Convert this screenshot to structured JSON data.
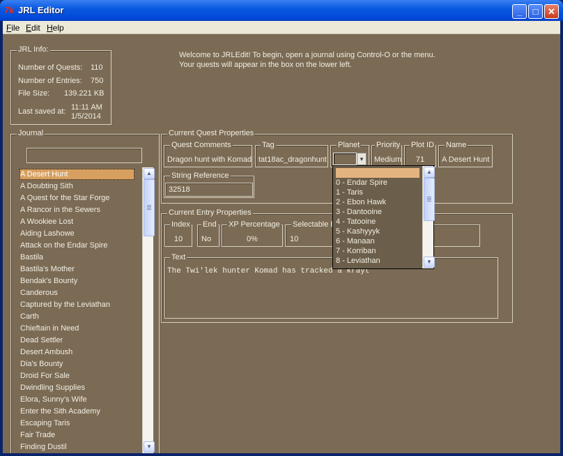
{
  "window": {
    "title": "JRL Editor",
    "min_label": "_",
    "max_label": "□",
    "close_label": "✕"
  },
  "menubar": {
    "file": "File",
    "edit": "Edit",
    "help": "Help"
  },
  "info": {
    "label": "JRL Info:",
    "quests_label": "Number of Quests:",
    "quests_value": "110",
    "entries_label": "Number of Entries:",
    "entries_value": "750",
    "filesize_label": "File Size:",
    "filesize_value": "139.221 KB",
    "lastsaved_label": "Last saved at:",
    "lastsaved_time": "11:11 AM",
    "lastsaved_date": "1/5/2014"
  },
  "welcome": {
    "line1": "Welcome to JRLEdit! To begin, open a journal using Control-O or the menu.",
    "line2": "Your quests will appear in the box on the lower left."
  },
  "journal": {
    "label": "Journal",
    "search_value": "",
    "items": [
      "A Desert Hunt",
      "A Doubting Sith",
      "A Quest for the Star Forge",
      "A Rancor in the Sewers",
      "A Wookiee Lost",
      "Aiding Lashowe",
      "Attack on the Endar Spire",
      "Bastila",
      "Bastila's Mother",
      "Bendak's Bounty",
      "Canderous",
      "Captured by the Leviathan",
      "Carth",
      "Chieftain in Need",
      "Dead Settler",
      "Desert Ambush",
      "Dia's Bounty",
      "Droid For Sale",
      "Dwindling Supplies",
      "Elora, Sunny's Wife",
      "Enter the Sith Academy",
      "Escaping Taris",
      "Fair Trade",
      "Finding Dustil"
    ]
  },
  "quest": {
    "label": "Current Quest Properties",
    "comments_label": "Quest Comments",
    "comments_value": "Dragon hunt with Komad",
    "tag_label": "Tag",
    "tag_value": "tat18ac_dragonhunt",
    "planet_label": "Planet",
    "planet_value": "",
    "priority_label": "Priority",
    "priority_value": "Medium",
    "plotid_label": "Plot ID",
    "plotid_value": "71",
    "name_label": "Name",
    "name_value": "A Desert Hunt",
    "strref_label": "String Reference",
    "strref_value": "32518",
    "dropdown_arrow": "▾"
  },
  "entry": {
    "label": "Current Entry Properties",
    "index_label": "Index",
    "index_value": "10",
    "end_label": "End",
    "end_value": "No",
    "xp_label": "XP Percentage",
    "xp_value": "0%",
    "selectable_label": "Selectable E",
    "selectable_value": "10",
    "text_label": "Text",
    "text_value": "The Twi'lek hunter Komad has tracked a krayt"
  },
  "planet_dropdown": {
    "options": [
      "",
      "0 - Endar Spire",
      "1 - Taris",
      "2 - Ebon Hawk",
      "3 - Dantooine",
      "4 - Tatooine",
      "5 - Kashyyyk",
      "6 - Manaan",
      "7 - Korriban",
      "8 - Leviathan"
    ]
  },
  "scroll": {
    "up": "▲",
    "down": "▼"
  },
  "colors": {
    "panel": "#7b6b55",
    "selection": "#d8a060",
    "titlebar": "#0a5ae0"
  }
}
